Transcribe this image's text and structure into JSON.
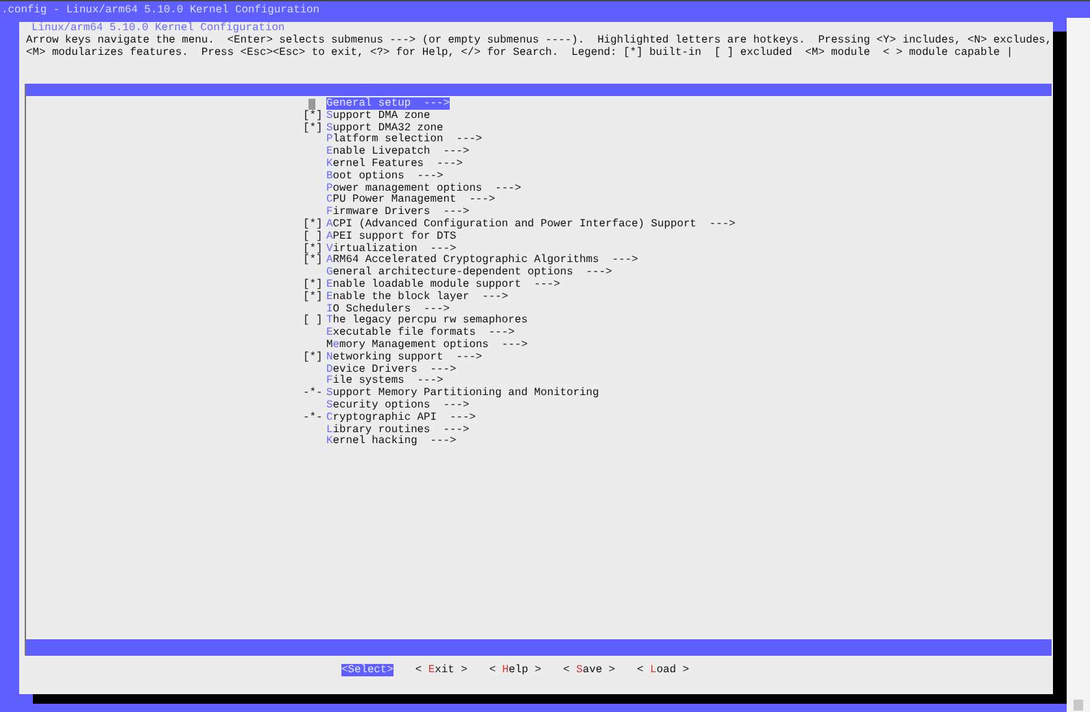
{
  "window": {
    "title": ".config - Linux/arm64 5.10.0 Kernel Configuration"
  },
  "dialog": {
    "title": "Linux/arm64 5.10.0 Kernel Configuration",
    "help": [
      "Arrow keys navigate the menu.  <Enter> selects submenus ---> (or empty submenus ----).  Highlighted letters are hotkeys.  Pressing <Y> includes, <N> excludes,",
      "<M> modularizes features.  Press <Esc><Esc> to exit, <?> for Help, </> for Search.  Legend: [*] built-in  [ ] excluded  <M> module  < > module capable |"
    ]
  },
  "menu": [
    {
      "hotkey": "G",
      "rest": "eneral setup  --->",
      "selected": true
    },
    {
      "prefix": "[*]",
      "hotkey": "S",
      "rest": "upport DMA zone",
      "selected": false
    },
    {
      "prefix": "[*]",
      "hotkey": "S",
      "rest": "upport DMA32 zone",
      "selected": false
    },
    {
      "hotkey": "P",
      "rest": "latform selection  --->",
      "selected": false
    },
    {
      "hotkey": "E",
      "rest": "nable Livepatch  --->",
      "selected": false
    },
    {
      "hotkey": "K",
      "rest": "ernel Features  --->",
      "selected": false
    },
    {
      "hotkey": "B",
      "rest": "oot options  --->",
      "selected": false
    },
    {
      "hotkey": "P",
      "rest": "ower management options  --->",
      "selected": false
    },
    {
      "hotkey": "C",
      "rest": "PU Power Management  --->",
      "selected": false
    },
    {
      "hotkey": "F",
      "rest": "irmware Drivers  --->",
      "selected": false
    },
    {
      "prefix": "[*]",
      "hotkey": "A",
      "rest": "CPI (Advanced Configuration and Power Interface) Support  --->",
      "selected": false
    },
    {
      "prefix": "[ ]",
      "hotkey": "A",
      "rest": "PEI support for DTS",
      "selected": false
    },
    {
      "prefix": "[*]",
      "hotkey": "V",
      "rest": "irtualization  --->",
      "selected": false
    },
    {
      "prefix": "[*]",
      "hotkey": "A",
      "rest": "RM64 Accelerated Cryptographic Algorithms  --->",
      "selected": false
    },
    {
      "hotkey": "G",
      "rest": "eneral architecture-dependent options  --->",
      "selected": false
    },
    {
      "prefix": "[*]",
      "hotkey": "E",
      "rest": "nable loadable module support  --->",
      "selected": false
    },
    {
      "prefix": "[*]",
      "hotkey": "E",
      "rest": "nable the block layer  --->",
      "selected": false
    },
    {
      "hotkey": "I",
      "rest": "O Schedulers  --->",
      "selected": false
    },
    {
      "prefix": "[ ]",
      "hotkey": "T",
      "rest": "he legacy percpu rw semaphores",
      "selected": false
    },
    {
      "hotkey": "E",
      "rest": "xecutable file formats  --->",
      "selected": false
    },
    {
      "lead": "M",
      "hotkey": "e",
      "rest": "mory Management options  --->",
      "selected": false
    },
    {
      "prefix": "[*]",
      "hotkey": "N",
      "rest": "etworking support  --->",
      "selected": false
    },
    {
      "hotkey": "D",
      "rest": "evice Drivers  --->",
      "selected": false
    },
    {
      "hotkey": "F",
      "rest": "ile systems  --->",
      "selected": false
    },
    {
      "prefix": "-*-",
      "hotkey": "S",
      "rest": "upport Memory Partitioning and Monitoring",
      "selected": false
    },
    {
      "hotkey": "S",
      "rest": "ecurity options  --->",
      "selected": false
    },
    {
      "prefix": "-*-",
      "hotkey": "C",
      "rest": "ryptographic API  --->",
      "selected": false
    },
    {
      "hotkey": "L",
      "rest": "ibrary routines  --->",
      "selected": false
    },
    {
      "hotkey": "K",
      "rest": "ernel hacking  --->",
      "selected": false
    }
  ],
  "buttons": [
    {
      "lead": "<Select>",
      "selected": true
    },
    {
      "lead": "< ",
      "hotkey": "E",
      "rest": "xit >",
      "selected": false
    },
    {
      "lead": "< ",
      "hotkey": "H",
      "rest": "elp >",
      "selected": false
    },
    {
      "lead": "< ",
      "hotkey": "S",
      "rest": "ave >",
      "selected": false
    },
    {
      "lead": "< ",
      "hotkey": "L",
      "rest": "oad >",
      "selected": false
    }
  ]
}
